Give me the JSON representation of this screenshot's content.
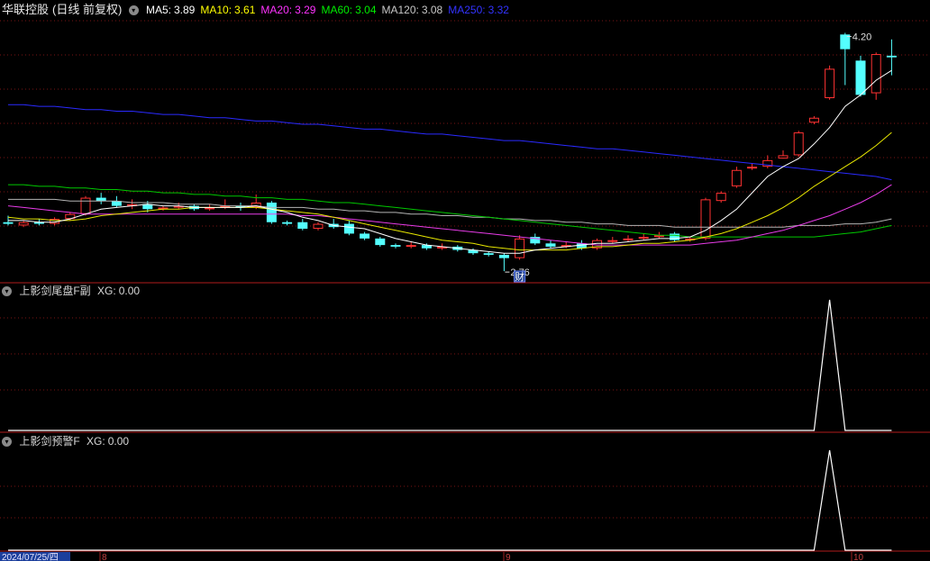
{
  "main_panel": {
    "stock_name": "华联控股",
    "period_label": "(日线 前复权)",
    "ma_labels": [
      {
        "name": "MA5:",
        "value": "3.89",
        "color": "#ffffff"
      },
      {
        "name": "MA10:",
        "value": "3.61",
        "color": "#ffff00"
      },
      {
        "name": "MA20:",
        "value": "3.29",
        "color": "#ff33ff"
      },
      {
        "name": "MA60:",
        "value": "3.04",
        "color": "#00ee00"
      },
      {
        "name": "MA120:",
        "value": "3.08",
        "color": "#c8c8c8"
      },
      {
        "name": "MA250:",
        "value": "3.32",
        "color": "#3333ff"
      }
    ],
    "high_marker": "4.20",
    "low_marker": "2.76",
    "event_marker": "财"
  },
  "indicator_1": {
    "title": "上影剑尾盘F副",
    "xg_label": "XG:",
    "xg_value": "0.00"
  },
  "indicator_2": {
    "title": "上影剑预警F",
    "xg_label": "XG:",
    "xg_value": "0.00"
  },
  "x_axis": {
    "date_label": "2024/07/25/四",
    "month_labels": [
      "8",
      "9",
      "10"
    ]
  },
  "chart_data": {
    "type": "candlestick",
    "up_color": "#ff3232",
    "down_color": "#54ffff",
    "y_range": [
      2.7,
      4.3
    ],
    "candles": [
      [
        3.06,
        3.1,
        3.05,
        3.04
      ],
      [
        3.04,
        3.07,
        3.06,
        3.03
      ],
      [
        3.06,
        3.08,
        3.05,
        3.04
      ],
      [
        3.05,
        3.09,
        3.08,
        3.04
      ],
      [
        3.08,
        3.12,
        3.11,
        3.07
      ],
      [
        3.11,
        3.22,
        3.21,
        3.1
      ],
      [
        3.21,
        3.24,
        3.19,
        3.17
      ],
      [
        3.19,
        3.22,
        3.16,
        3.15
      ],
      [
        3.16,
        3.2,
        3.17,
        3.14
      ],
      [
        3.17,
        3.19,
        3.14,
        3.12
      ],
      [
        3.14,
        3.16,
        3.15,
        3.13
      ],
      [
        3.15,
        3.18,
        3.16,
        3.14
      ],
      [
        3.16,
        3.17,
        3.14,
        3.13
      ],
      [
        3.14,
        3.17,
        3.15,
        3.13
      ],
      [
        3.15,
        3.2,
        3.16,
        3.14
      ],
      [
        3.16,
        3.18,
        3.15,
        3.13
      ],
      [
        3.15,
        3.23,
        3.18,
        3.14
      ],
      [
        3.18,
        3.19,
        3.06,
        3.05
      ],
      [
        3.06,
        3.07,
        3.05,
        3.04
      ],
      [
        3.06,
        3.08,
        3.02,
        3.01
      ],
      [
        3.02,
        3.06,
        3.05,
        3.01
      ],
      [
        3.05,
        3.08,
        3.03,
        3.02
      ],
      [
        3.05,
        3.07,
        2.99,
        2.98
      ],
      [
        2.99,
        3.0,
        2.96,
        2.95
      ],
      [
        2.96,
        2.97,
        2.92,
        2.91
      ],
      [
        2.92,
        2.93,
        2.91,
        2.9
      ],
      [
        2.91,
        2.94,
        2.92,
        2.9
      ],
      [
        2.92,
        2.93,
        2.9,
        2.89
      ],
      [
        2.9,
        2.93,
        2.91,
        2.89
      ],
      [
        2.91,
        2.92,
        2.89,
        2.88
      ],
      [
        2.89,
        2.9,
        2.87,
        2.86
      ],
      [
        2.87,
        2.88,
        2.86,
        2.85
      ],
      [
        2.86,
        2.87,
        2.84,
        2.76
      ],
      [
        2.84,
        2.98,
        2.96,
        2.83
      ],
      [
        2.97,
        2.99,
        2.93,
        2.92
      ],
      [
        2.93,
        2.95,
        2.91,
        2.9
      ],
      [
        2.91,
        2.94,
        2.92,
        2.9
      ],
      [
        2.93,
        2.95,
        2.9,
        2.89
      ],
      [
        2.9,
        2.96,
        2.95,
        2.89
      ],
      [
        2.94,
        2.97,
        2.95,
        2.93
      ],
      [
        2.95,
        2.98,
        2.96,
        2.94
      ],
      [
        2.96,
        2.99,
        2.97,
        2.95
      ],
      [
        2.97,
        3.0,
        2.98,
        2.96
      ],
      [
        2.99,
        3.0,
        2.95,
        2.94
      ],
      [
        2.95,
        2.97,
        2.96,
        2.94
      ],
      [
        2.96,
        3.21,
        3.2,
        2.95
      ],
      [
        3.19,
        3.25,
        3.24,
        3.18
      ],
      [
        3.28,
        3.4,
        3.38,
        3.27
      ],
      [
        3.39,
        3.42,
        3.4,
        3.38
      ],
      [
        3.4,
        3.47,
        3.44,
        3.39
      ],
      [
        3.45,
        3.5,
        3.47,
        3.45
      ],
      [
        3.47,
        3.62,
        3.61,
        3.46
      ],
      [
        3.67,
        3.71,
        3.7,
        3.66
      ],
      [
        3.82,
        4.02,
        4.0,
        3.81
      ],
      [
        4.21,
        4.22,
        4.12,
        3.9
      ],
      [
        4.05,
        4.08,
        3.84,
        3.83
      ],
      [
        3.85,
        4.1,
        4.09,
        3.81
      ],
      [
        4.08,
        4.18,
        4.07,
        3.96
      ]
    ],
    "ma5": [
      3.07,
      3.07,
      3.06,
      3.06,
      3.08,
      3.11,
      3.14,
      3.15,
      3.16,
      3.17,
      3.16,
      3.16,
      3.15,
      3.15,
      3.15,
      3.15,
      3.16,
      3.14,
      3.12,
      3.09,
      3.07,
      3.04,
      3.03,
      3.02,
      2.99,
      2.96,
      2.94,
      2.92,
      2.91,
      2.9,
      2.89,
      2.88,
      2.87,
      2.87,
      2.89,
      2.9,
      2.91,
      2.92,
      2.93,
      2.93,
      2.94,
      2.95,
      2.96,
      2.96,
      2.97,
      3.01,
      3.07,
      3.14,
      3.24,
      3.34,
      3.4,
      3.45,
      3.54,
      3.64,
      3.77,
      3.84,
      3.93,
      3.99
    ],
    "ma10": [
      3.09,
      3.08,
      3.08,
      3.07,
      3.07,
      3.08,
      3.1,
      3.11,
      3.12,
      3.13,
      3.14,
      3.14,
      3.15,
      3.15,
      3.15,
      3.15,
      3.15,
      3.14,
      3.13,
      3.12,
      3.11,
      3.09,
      3.07,
      3.05,
      3.03,
      3.01,
      2.99,
      2.97,
      2.95,
      2.94,
      2.93,
      2.91,
      2.9,
      2.89,
      2.89,
      2.89,
      2.89,
      2.9,
      2.91,
      2.91,
      2.92,
      2.93,
      2.93,
      2.94,
      2.95,
      2.97,
      2.99,
      3.02,
      3.06,
      3.1,
      3.15,
      3.21,
      3.28,
      3.34,
      3.4,
      3.46,
      3.53,
      3.61
    ],
    "ma20": [
      3.16,
      3.15,
      3.14,
      3.13,
      3.12,
      3.11,
      3.11,
      3.11,
      3.11,
      3.11,
      3.11,
      3.11,
      3.11,
      3.11,
      3.11,
      3.11,
      3.11,
      3.11,
      3.11,
      3.1,
      3.1,
      3.09,
      3.08,
      3.07,
      3.06,
      3.05,
      3.04,
      3.03,
      3.02,
      3.01,
      3.0,
      2.99,
      2.98,
      2.97,
      2.96,
      2.95,
      2.94,
      2.93,
      2.92,
      2.92,
      2.92,
      2.92,
      2.92,
      2.92,
      2.92,
      2.93,
      2.94,
      2.95,
      2.97,
      2.99,
      3.01,
      3.04,
      3.07,
      3.1,
      3.14,
      3.18,
      3.23,
      3.29
    ],
    "ma60": [
      3.29,
      3.29,
      3.28,
      3.28,
      3.27,
      3.27,
      3.26,
      3.26,
      3.25,
      3.25,
      3.24,
      3.24,
      3.23,
      3.23,
      3.22,
      3.22,
      3.21,
      3.21,
      3.2,
      3.2,
      3.19,
      3.18,
      3.18,
      3.17,
      3.16,
      3.15,
      3.14,
      3.13,
      3.12,
      3.11,
      3.1,
      3.09,
      3.08,
      3.07,
      3.06,
      3.05,
      3.04,
      3.03,
      3.02,
      3.01,
      3.0,
      2.99,
      2.98,
      2.98,
      2.97,
      2.97,
      2.97,
      2.97,
      2.97,
      2.97,
      2.97,
      2.97,
      2.97,
      2.98,
      2.99,
      3.0,
      3.02,
      3.04
    ],
    "ma120": [
      3.2,
      3.2,
      3.2,
      3.2,
      3.19,
      3.19,
      3.19,
      3.19,
      3.18,
      3.18,
      3.18,
      3.17,
      3.17,
      3.17,
      3.16,
      3.16,
      3.16,
      3.15,
      3.15,
      3.15,
      3.14,
      3.14,
      3.13,
      3.13,
      3.12,
      3.12,
      3.11,
      3.11,
      3.1,
      3.1,
      3.09,
      3.09,
      3.08,
      3.08,
      3.07,
      3.07,
      3.06,
      3.06,
      3.05,
      3.05,
      3.04,
      3.04,
      3.04,
      3.03,
      3.03,
      3.03,
      3.03,
      3.03,
      3.03,
      3.03,
      3.03,
      3.04,
      3.04,
      3.04,
      3.05,
      3.05,
      3.06,
      3.08
    ],
    "ma250": [
      3.78,
      3.78,
      3.77,
      3.77,
      3.76,
      3.75,
      3.75,
      3.74,
      3.74,
      3.73,
      3.72,
      3.72,
      3.71,
      3.7,
      3.7,
      3.69,
      3.68,
      3.68,
      3.67,
      3.66,
      3.66,
      3.65,
      3.64,
      3.63,
      3.63,
      3.62,
      3.61,
      3.6,
      3.6,
      3.59,
      3.58,
      3.57,
      3.56,
      3.56,
      3.55,
      3.54,
      3.53,
      3.52,
      3.51,
      3.51,
      3.5,
      3.49,
      3.48,
      3.47,
      3.46,
      3.45,
      3.44,
      3.43,
      3.42,
      3.41,
      3.4,
      3.39,
      3.38,
      3.37,
      3.36,
      3.35,
      3.34,
      3.32
    ],
    "xg_1": [
      0,
      0,
      0,
      0,
      0,
      0,
      0,
      0,
      0,
      0,
      0,
      0,
      0,
      0,
      0,
      0,
      0,
      0,
      0,
      0,
      0,
      0,
      0,
      0,
      0,
      0,
      0,
      0,
      0,
      0,
      0,
      0,
      0,
      0,
      0,
      0,
      0,
      0,
      0,
      0,
      0,
      0,
      0,
      0,
      0,
      0,
      0,
      0,
      0,
      0,
      0,
      0,
      0,
      1,
      0,
      0,
      0,
      0
    ],
    "xg_2": [
      0,
      0,
      0,
      0,
      0,
      0,
      0,
      0,
      0,
      0,
      0,
      0,
      0,
      0,
      0,
      0,
      0,
      0,
      0,
      0,
      0,
      0,
      0,
      0,
      0,
      0,
      0,
      0,
      0,
      0,
      0,
      0,
      0,
      0,
      0,
      0,
      0,
      0,
      0,
      0,
      0,
      0,
      0,
      0,
      0,
      0,
      0,
      0,
      0,
      0,
      0,
      0,
      0,
      1,
      0,
      0,
      0,
      0
    ]
  }
}
